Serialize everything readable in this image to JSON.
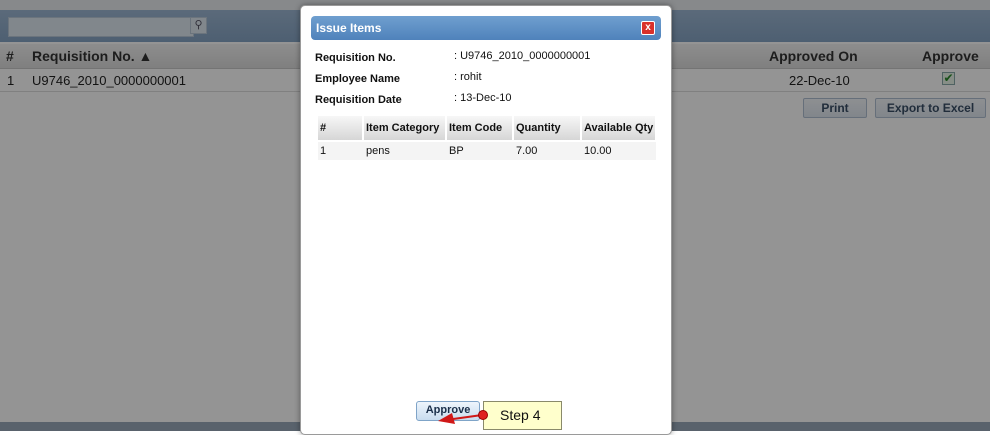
{
  "background": {
    "search_placeholder": "",
    "search_icon": "magnifier-icon",
    "columns": [
      "#",
      "Requisition No. ▲",
      "Approved On",
      "Approve"
    ],
    "row": {
      "index": "1",
      "requisition_no": "U9746_2010_0000000001",
      "approved_on": "22-Dec-10",
      "approved": true
    },
    "buttons": {
      "print": "Print",
      "export": "Export to Excel"
    }
  },
  "modal": {
    "title": "Issue Items",
    "close_label": "x",
    "fields": {
      "requisition_no": {
        "label": "Requisition No.",
        "value": ": U9746_2010_0000000001"
      },
      "employee_name": {
        "label": "Employee Name",
        "value": ": rohit"
      },
      "requisition_date": {
        "label": "Requisition Date",
        "value": ": 13-Dec-10"
      }
    },
    "table": {
      "headers": [
        "#",
        "Item Category",
        "Item Code",
        "Quantity",
        "Available Qty"
      ],
      "rows": [
        [
          "1",
          "pens",
          "BP",
          "7.00",
          "10.00"
        ]
      ]
    },
    "approve_label": "Approve"
  },
  "callout": {
    "text": "Step 4"
  },
  "colors": {
    "accent": "#4f82bb",
    "close": "#d9312b",
    "callout": "#ffffcc"
  }
}
